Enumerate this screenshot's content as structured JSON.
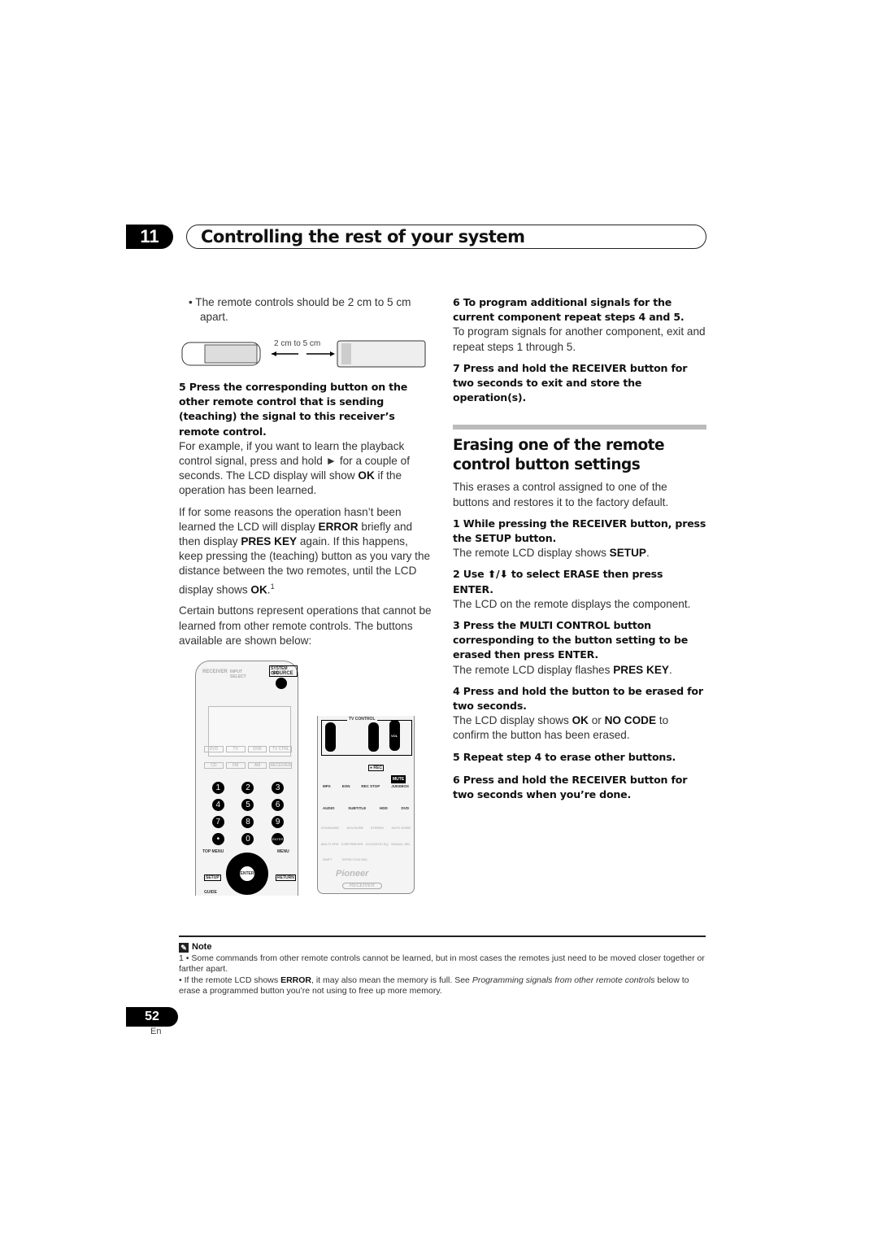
{
  "header": {
    "chapter": "11",
    "title": "Controlling the rest of your system"
  },
  "left": {
    "bullet": "The remote controls should be 2 cm to 5 cm apart.",
    "distance_label": "2 cm to 5 cm",
    "step5_title": "5   Press the corresponding button on the other remote control that is sending (teaching) the signal to this receiver’s remote control.",
    "p1": [
      "For example, if you want to learn the playback control signal, press and hold ► for a couple of seconds. The LCD display will show ",
      "OK",
      " if the operation has been learned."
    ],
    "p2": [
      "If for some reasons the operation hasn’t been learned the LCD will display ",
      "ERROR",
      " briefly and then display ",
      "PRES KEY",
      " again. If this happens, keep pressing the (teaching) button as you vary the distance between the two remotes, until the LCD display shows ",
      "OK",
      ".",
      "1"
    ],
    "p3": "Certain buttons represent operations that cannot be learned from other remote controls. The buttons available are shown below:"
  },
  "remote_fig": {
    "receiver": "RECEIVER",
    "input_select": "INPUT SELECT",
    "system_off": "SYSTEM OFF",
    "source": "SOURCE",
    "inputs": [
      "DVD",
      "TV",
      "DVR",
      "TV CTRL",
      "CD",
      "FM",
      "AM",
      "RECEIVER"
    ],
    "digits": [
      "1",
      "2",
      "3",
      "4",
      "5",
      "6",
      "7",
      "8",
      "9",
      "•",
      "0",
      "ENTER"
    ],
    "top_menu": "TOP MENU",
    "menu": "MENU",
    "setup": "SETUP",
    "return": "RETURN",
    "guide": "GUIDE",
    "enter": "ENTER",
    "tv_control": "TV CONTROL",
    "tv_vol": "TV VOL",
    "tv_ch": "TV CH",
    "vol": "VOL",
    "mute": "MUTE",
    "rec": "● REC",
    "row_labels": [
      "MPX",
      "EON",
      "REC STOP",
      "JUKEBOX"
    ],
    "row2_labels": [
      "AUDIO",
      "SUBTITLE",
      "HDD",
      "DVD"
    ],
    "surround": [
      "STANDARD",
      "ADV.SURR",
      "STEREO",
      "AUTO SURR"
    ],
    "surround2": [
      "MULTI OPE",
      "S.RETRIEVER",
      "ACOUSTIC EQ",
      "SIGNAL SEL"
    ],
    "shift": "SHIFT",
    "effect": "EFFECT/CH SEL",
    "brand": "Pioneer",
    "bottom": "RECEIVER"
  },
  "right": {
    "step6_title": "6   To program additional signals for the current component repeat steps 4 and 5.",
    "step6_text": "To program signals for another component, exit and repeat steps 1 through 5.",
    "step7_title": "7   Press and hold the RECEIVER button for two seconds to exit and store the operation(s).",
    "section_title": "Erasing one of the remote control button settings",
    "intro": "This erases a control assigned to one of the buttons and restores it to the factory default.",
    "s1_title": "1   While pressing the RECEIVER button, press the SETUP button.",
    "s1_text": [
      "The remote LCD display shows ",
      "SETUP",
      "."
    ],
    "s2_title": "2   Use ⬆/⬇ to select ERASE then press ENTER.",
    "s2_text": "The LCD on the remote displays the component.",
    "s3_title": "3   Press the MULTI CONTROL button corresponding to the button setting to be erased then press ENTER.",
    "s3_text": [
      "The remote LCD display flashes ",
      "PRES KEY",
      "."
    ],
    "s4_title": "4   Press and hold the button to be erased for two seconds.",
    "s4_text": [
      "The LCD display shows ",
      "OK",
      " or ",
      "NO CODE",
      " to confirm the button has been erased."
    ],
    "s5_title": "5   Repeat step 4 to erase other buttons.",
    "s6_title": "6   Press and hold the RECEIVER button for two seconds when you’re done."
  },
  "note": {
    "heading": "Note",
    "line1": "1  • Some commands from other remote controls cannot be learned, but in most cases the remotes just need to be moved closer together or farther apart.",
    "line2": [
      "  • If the remote LCD shows ",
      "ERROR",
      ", it may also mean the memory is full. See ",
      "Programming signals from other remote controls",
      " below to erase a programmed button you’re not using to free up more memory."
    ]
  },
  "footer": {
    "page": "52",
    "lang": "En"
  }
}
